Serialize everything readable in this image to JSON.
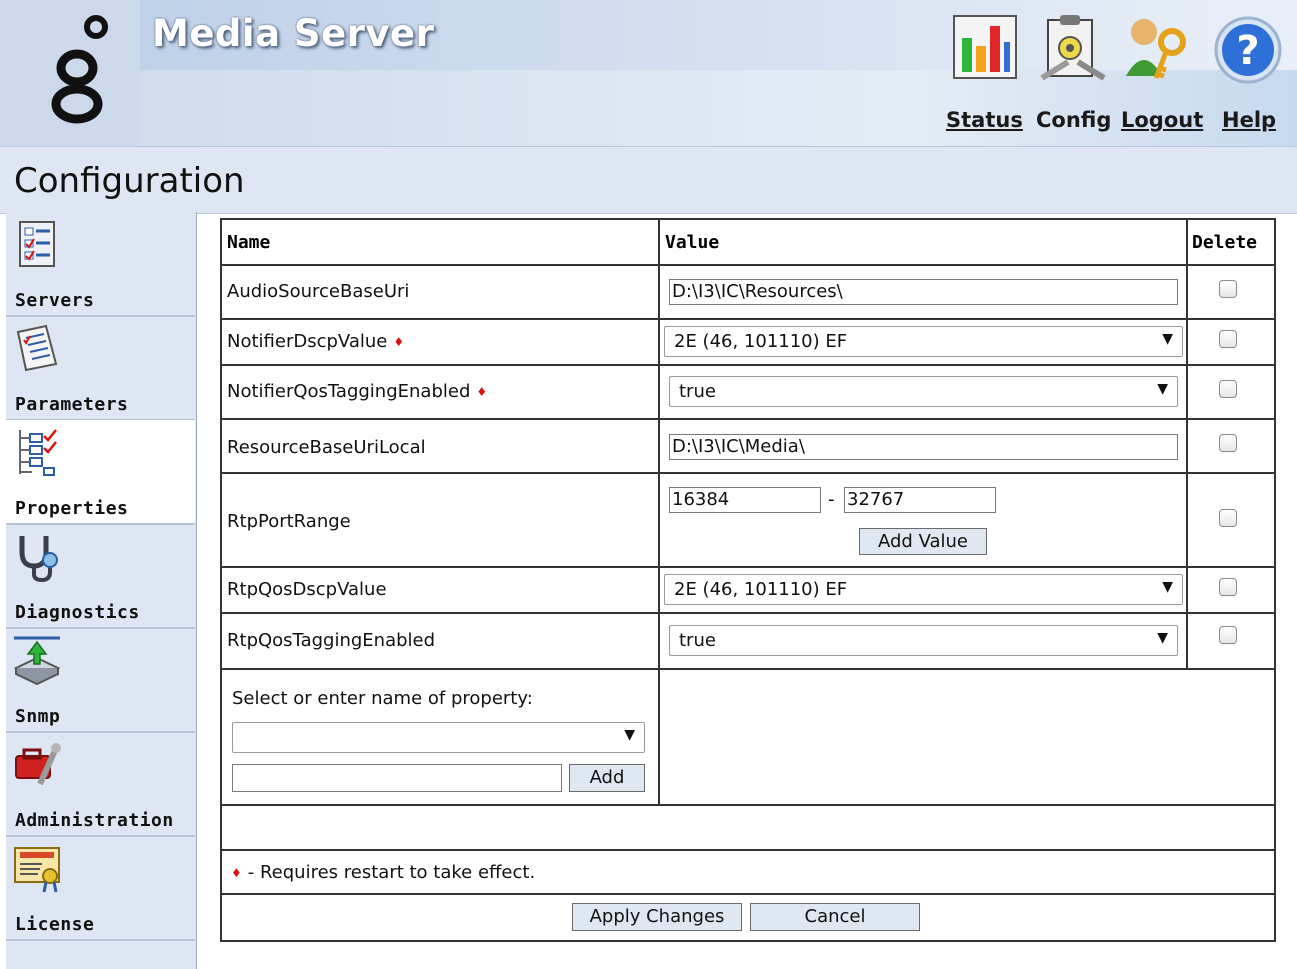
{
  "header": {
    "app_title": "Media Server",
    "links": {
      "status": "Status",
      "config": "Config",
      "logout": "Logout",
      "help": "Help"
    },
    "icons": [
      "status-chart-icon",
      "config-clipboard-icon",
      "logout-keys-icon",
      "help-question-icon"
    ]
  },
  "page": {
    "title": "Configuration"
  },
  "sidebar": {
    "items": [
      {
        "label": "Servers",
        "icon": "servers-checklist-icon"
      },
      {
        "label": "Parameters",
        "icon": "parameters-document-icon"
      },
      {
        "label": "Properties",
        "icon": "properties-tree-icon"
      },
      {
        "label": "Diagnostics",
        "icon": "stethoscope-icon"
      },
      {
        "label": "Snmp",
        "icon": "snmp-network-icon"
      },
      {
        "label": "Administration",
        "icon": "toolbox-icon"
      },
      {
        "label": "License",
        "icon": "license-certificate-icon"
      }
    ],
    "active": "Properties"
  },
  "table": {
    "headers": {
      "name": "Name",
      "value": "Value",
      "delete": "Delete"
    },
    "rows": [
      {
        "name": "AudioSourceBaseUri",
        "value": "D:\\I3\\IC\\Resources\\",
        "control": "text",
        "restart": false
      },
      {
        "name": "NotifierDscpValue",
        "value": "2E (46, 101110) EF",
        "control": "select",
        "restart": true
      },
      {
        "name": "NotifierQosTaggingEnabled",
        "value": "true",
        "control": "select",
        "restart": true
      },
      {
        "name": "ResourceBaseUriLocal",
        "value": "D:\\I3\\IC\\Media\\",
        "control": "text",
        "restart": false
      },
      {
        "name": "RtpPortRange",
        "range_start": "16384",
        "range_separator": "-",
        "range_end": "32767",
        "add_value_label": "Add Value",
        "control": "range",
        "restart": false
      },
      {
        "name": "RtpQosDscpValue",
        "value": "2E (46, 101110) EF",
        "control": "select",
        "restart": false
      },
      {
        "name": "RtpQosTaggingEnabled",
        "value": "true",
        "control": "select",
        "restart": false
      }
    ],
    "add_property": {
      "label": "Select or enter name of property:",
      "select_value": "",
      "input_value": "",
      "add_label": "Add"
    },
    "restart_marker": "♦",
    "footnote": "- Requires restart to take effect.",
    "actions": {
      "apply": "Apply Changes",
      "cancel": "Cancel"
    }
  },
  "colors": {
    "header_bg": "#d6e2f0",
    "sidebar_bg": "#dde6f2",
    "restart_marker": "#dd1111"
  }
}
